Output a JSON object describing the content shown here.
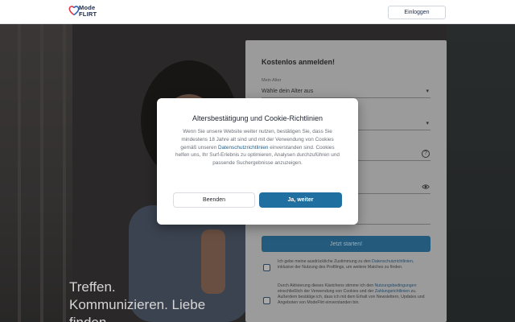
{
  "header": {
    "logo_line1": "Mode",
    "logo_line2": "FLIRT",
    "login_label": "Einloggen"
  },
  "hero": {
    "slogan_line1": "Treffen.",
    "slogan_line2": "Kommunizieren. Liebe",
    "slogan_line3": "finden."
  },
  "signup": {
    "title": "Kostenlos anmelden!",
    "age_label": "Mein Alter",
    "age_value": "Wähle dein Alter aus",
    "start_label": "Jetzt starten!",
    "consent1_before": "Ich gebe meine ausdrückliche Zustimmung zu den ",
    "consent1_link": "Datenschutzrichtlinien",
    "consent1_after": ", inklusive der Nutzung des Profilings, um weitere Matches zu finden.",
    "consent2_before": "Durch Aktivierung dieses Kästchens stimme ich den ",
    "consent2_link1": "Nutzungsbedingungen",
    "consent2_mid": " einschließlich der Verwendung von Cookies und der ",
    "consent2_link2": "Zahlungsrichtlinien",
    "consent2_after": " zu. Außerdem bestätige ich, dass ich mit dem Erhalt von Newslettern, Updates und Angeboten von ModeFlirt einverstanden bin."
  },
  "modal": {
    "title": "Altersbestätigung und Cookie-Richtlinien",
    "body_before": "Wenn Sie unsere Website weiter nutzen, bestätigen Sie, dass Sie mindestens 18 Jahre alt sind und mit der Verwendung von Cookies gemäß unseren ",
    "body_link": "Datenschutzrichtlinien",
    "body_after": " einverstanden sind. Cookies helfen uns, Ihr Surf-Erlebnis zu optimieren, Analysen durchzuführen und passende Suchergebnisse anzuzeigen.",
    "decline_label": "Beenden",
    "accept_label": "Ja, weiter"
  },
  "colors": {
    "accent": "#1f6fa1",
    "logo_heart_red": "#e5354b",
    "logo_heart_blue": "#2a63b7"
  },
  "icons": [
    "heart-logo-icon",
    "chevron-down-icon",
    "help-icon",
    "eye-icon"
  ]
}
